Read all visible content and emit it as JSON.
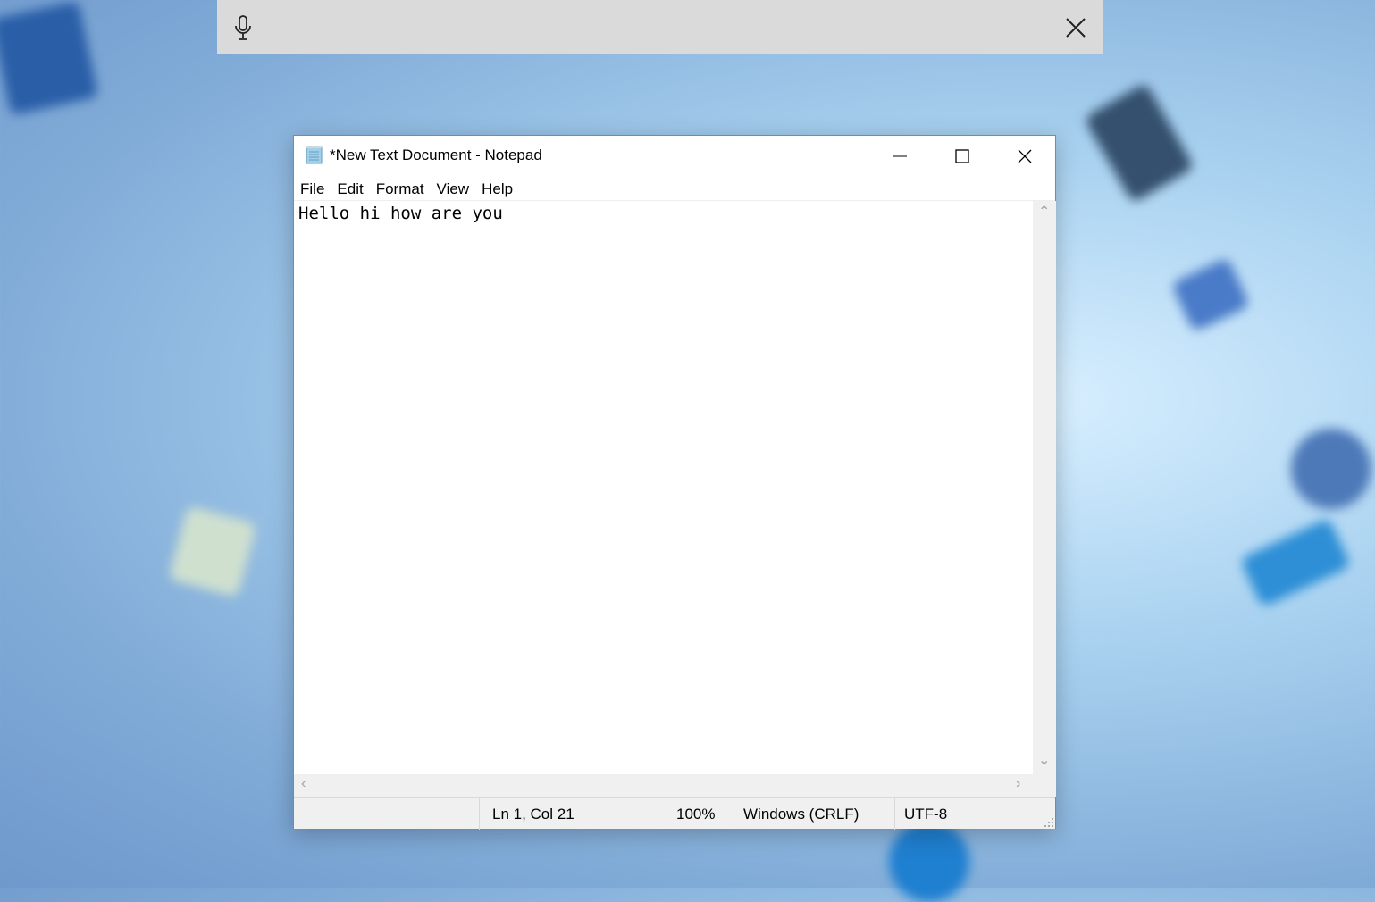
{
  "voice_bar": {
    "mic_icon": "microphone-icon",
    "close_icon": "close-icon"
  },
  "window": {
    "title": "*New Text Document - Notepad",
    "menu": [
      "File",
      "Edit",
      "Format",
      "View",
      "Help"
    ],
    "content": "Hello hi how are you",
    "status": {
      "position": "Ln 1, Col 21",
      "zoom": "100%",
      "line_ending": "Windows (CRLF)",
      "encoding": "UTF-8"
    }
  }
}
